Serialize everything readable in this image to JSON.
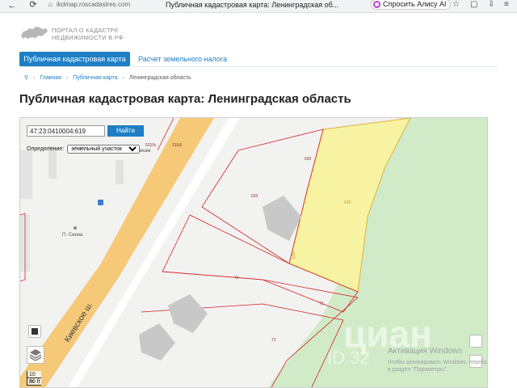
{
  "browser": {
    "address": "ikdmap.roscadastres.com",
    "tab_title": "Публичная кадастровая карта: Ленинградская об...",
    "alice_label": "Спросить Алису AI"
  },
  "header": {
    "logo_line1": "ПОРТАЛ О КАДАСТРЕ",
    "logo_line2": "НЕДВИЖИМОСТИ В РФ"
  },
  "nav": {
    "tabs": [
      {
        "label": "Публичная кадастровая карта"
      },
      {
        "label": "Расчет земельного налога"
      }
    ]
  },
  "breadcrumb": {
    "items": [
      "Главная",
      "Публичная карта",
      "Ленинградская область"
    ]
  },
  "page_title": "Публичная кадастровая карта: Ленинградская область",
  "map": {
    "search_value": "47:23:0410004:619",
    "search_button": "Найти",
    "definition_label": "Определение:",
    "definition_selected": "земельный участок",
    "road_label": "Киевское ш.",
    "place_label": "П. Сиина",
    "poi_label": "Поилодии земекам",
    "parcel_labels": [
      "5210с",
      "311/6",
      "620",
      "620",
      "619",
      "619",
      "71",
      "71",
      "71"
    ],
    "scale_m": "10 m",
    "scale_ft": "30 ft",
    "watermark_title": "Активация Windows",
    "watermark_text": "Чтобы активировать Windows, перейдите в раздел \"Параметры\".",
    "cian_text": "циан",
    "cian_id": "ID 32"
  },
  "colors": {
    "accent": "#1e7fc4",
    "parcel_border": "#d22323",
    "selected_fill": "#f7f3a0",
    "forest": "#d4eccb",
    "road": "#f5c97a"
  }
}
